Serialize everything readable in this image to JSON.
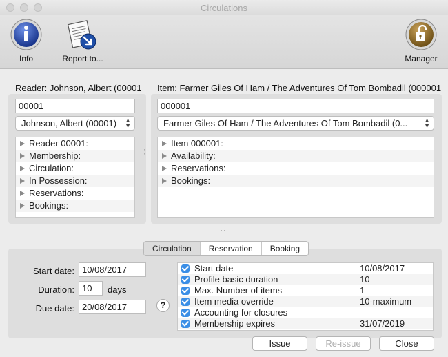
{
  "window": {
    "title": "Circulations"
  },
  "toolbar": {
    "info_label": "Info",
    "report_label": "Report to...",
    "manager_label": "Manager"
  },
  "reader": {
    "header": "Reader: Johnson, Albert (00001",
    "id_value": "00001",
    "popup_value": "Johnson, Albert (00001)",
    "tree": [
      "Reader 00001:",
      "Membership:",
      "Circulation:",
      "In Possession:",
      "Reservations:",
      "Bookings:"
    ]
  },
  "item": {
    "header": "Item: Farmer Giles Of Ham / The Adventures Of Tom Bombadil (000001",
    "id_value": "000001",
    "popup_value": "Farmer Giles Of Ham / The Adventures Of Tom Bombadil (0...",
    "tree": [
      "Item 000001:",
      "Availability:",
      "Reservations:",
      "Bookings:"
    ]
  },
  "tabs": [
    "Circulation",
    "Reservation",
    "Booking"
  ],
  "form": {
    "start_label": "Start date:",
    "start_value": "10/08/2017",
    "duration_label": "Duration:",
    "duration_value": "10",
    "duration_unit": "days",
    "due_label": "Due date:",
    "due_value": "20/08/2017",
    "help_label": "?"
  },
  "rules": [
    {
      "name": "Start date",
      "value": "10/08/2017"
    },
    {
      "name": "Profile basic duration",
      "value": "10"
    },
    {
      "name": "Max. Number of items",
      "value": "1"
    },
    {
      "name": "Item media override",
      "value": "10-maximum"
    },
    {
      "name": "Accounting for closures",
      "value": ""
    },
    {
      "name": "Membership expires",
      "value": "31/07/2019"
    }
  ],
  "buttons": {
    "issue": "Issue",
    "reissue": "Re-issue",
    "close": "Close"
  },
  "colors": {
    "accent": "#3a8ee6",
    "info_icon": "#1e3f9b",
    "manager_icon": "#8a6a28"
  }
}
